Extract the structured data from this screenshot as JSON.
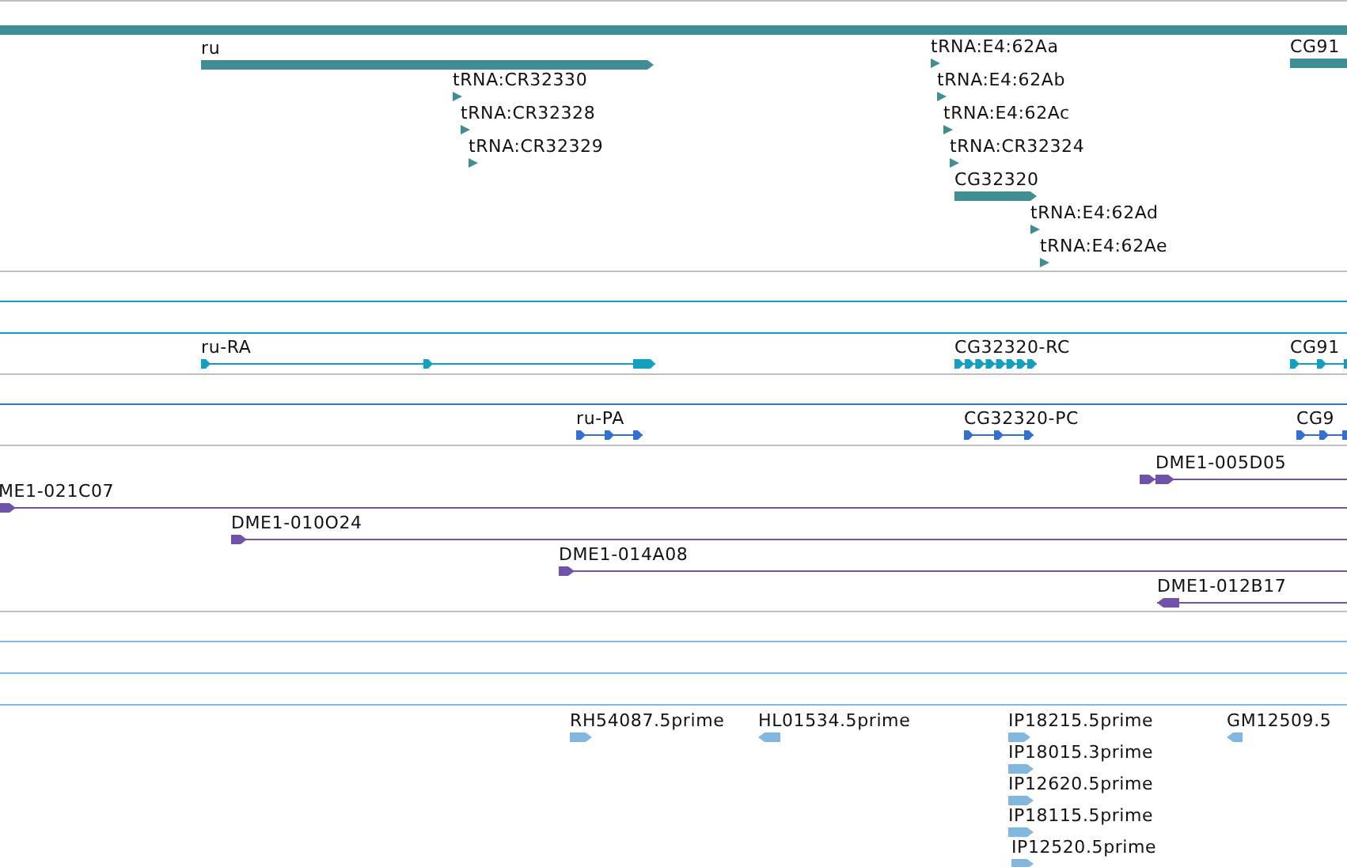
{
  "tracks": [
    {
      "color": "#3e8e93",
      "features": [
        {
          "label": "ru",
          "kind": "gene",
          "reverse": false
        },
        {
          "label": "tRNA:CR32330",
          "kind": "trna",
          "reverse": false
        },
        {
          "label": "tRNA:CR32328",
          "kind": "trna",
          "reverse": false
        },
        {
          "label": "tRNA:CR32329",
          "kind": "trna",
          "reverse": false
        },
        {
          "label": "tRNA:E4:62Aa",
          "kind": "trna",
          "reverse": false
        },
        {
          "label": "tRNA:E4:62Ab",
          "kind": "trna",
          "reverse": false
        },
        {
          "label": "tRNA:E4:62Ac",
          "kind": "trna",
          "reverse": false
        },
        {
          "label": "tRNA:CR32324",
          "kind": "trna",
          "reverse": false
        },
        {
          "label": "CG32320",
          "kind": "gene",
          "reverse": false
        },
        {
          "label": "tRNA:E4:62Ad",
          "kind": "trna",
          "reverse": false
        },
        {
          "label": "tRNA:E4:62Ae",
          "kind": "trna",
          "reverse": false
        },
        {
          "label": "CG91",
          "kind": "gene",
          "reverse": false
        }
      ]
    },
    {
      "color": "#13a0c0",
      "features": [
        {
          "label": "ru-RA",
          "kind": "transcript",
          "reverse": false
        },
        {
          "label": "CG32320-RC",
          "kind": "transcript",
          "reverse": false
        },
        {
          "label": "CG91",
          "kind": "transcript",
          "reverse": false
        }
      ]
    },
    {
      "color": "#3470d0",
      "features": [
        {
          "label": "ru-PA",
          "kind": "transcript",
          "reverse": false
        },
        {
          "label": "CG32320-PC",
          "kind": "transcript",
          "reverse": false
        },
        {
          "label": "CG9",
          "kind": "transcript",
          "reverse": false
        }
      ]
    },
    {
      "color": "#7052a8",
      "features": [
        {
          "label": "DME1-005D05",
          "kind": "clone",
          "reverse": false
        },
        {
          "label": "ME1-021C07",
          "kind": "clone",
          "reverse": false
        },
        {
          "label": "DME1-010O24",
          "kind": "clone",
          "reverse": false
        },
        {
          "label": "DME1-014A08",
          "kind": "clone",
          "reverse": false
        },
        {
          "label": "DME1-012B17",
          "kind": "clone",
          "reverse": true
        }
      ]
    },
    {
      "color": "#82b8e0",
      "features": [
        {
          "label": "RH54087.5prime",
          "kind": "est",
          "reverse": false
        },
        {
          "label": "HL01534.5prime",
          "kind": "est",
          "reverse": true
        },
        {
          "label": "IP18215.5prime",
          "kind": "est",
          "reverse": false
        },
        {
          "label": "GM12509.5",
          "kind": "est",
          "reverse": true
        },
        {
          "label": "IP18015.3prime",
          "kind": "est",
          "reverse": false
        },
        {
          "label": "IP12620.5prime",
          "kind": "est",
          "reverse": false
        },
        {
          "label": "IP18115.5prime",
          "kind": "est",
          "reverse": false
        },
        {
          "label": "IP12520.5prime",
          "kind": "est",
          "reverse": false
        }
      ]
    }
  ]
}
